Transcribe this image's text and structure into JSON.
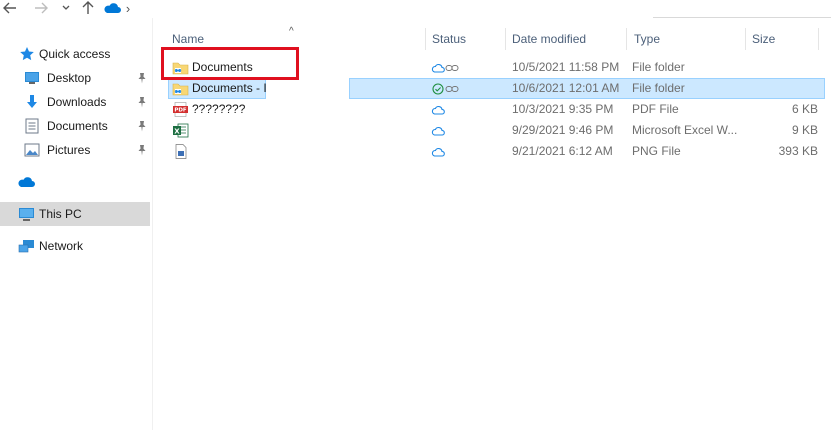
{
  "window": {
    "nav": {
      "back_icon": "back-arrow-icon",
      "forward_icon": "forward-arrow-icon",
      "recent_icon": "chevron-down-icon",
      "up_icon": "up-arrow-icon"
    },
    "address": {
      "location_icon": "onedrive-cloud-icon",
      "separator": "›"
    }
  },
  "sidebar": {
    "items": [
      {
        "label": "Quick access",
        "icon": "star-icon"
      },
      {
        "label": "Desktop",
        "icon": "desktop-icon",
        "pinned": true
      },
      {
        "label": "Downloads",
        "icon": "download-icon",
        "pinned": true
      },
      {
        "label": "Documents",
        "icon": "documents-icon",
        "pinned": true
      },
      {
        "label": "Pictures",
        "icon": "pictures-icon",
        "pinned": true
      },
      {
        "label": "",
        "icon": "onedrive-cloud-icon"
      },
      {
        "label": "This PC",
        "icon": "pc-icon",
        "selected": true
      },
      {
        "label": "Network",
        "icon": "network-icon"
      }
    ]
  },
  "columns": {
    "sort_indicator": "^",
    "name": "Name",
    "status": "Status",
    "date_modified": "Date modified",
    "type": "Type",
    "size": "Size"
  },
  "files": [
    {
      "name": "Documents",
      "icon": "shared-folder-icon",
      "status": "cloud-link",
      "date": "10/5/2021 11:58 PM",
      "type": "File folder",
      "size": ""
    },
    {
      "name": "Documents - I",
      "icon": "shared-folder-icon",
      "status": "synced-link",
      "date": "10/6/2021 12:01 AM",
      "type": "File folder",
      "size": "",
      "selected": true
    },
    {
      "name": "????????",
      "icon": "pdf-file-icon",
      "status": "cloud",
      "date": "10/3/2021 9:35 PM",
      "type": "PDF File",
      "size": "6 KB"
    },
    {
      "name": "",
      "icon": "excel-file-icon",
      "status": "cloud",
      "date": "9/29/2021 9:46 PM",
      "type": "Microsoft Excel W...",
      "size": "9 KB"
    },
    {
      "name": "",
      "icon": "png-file-icon",
      "status": "cloud",
      "date": "9/21/2021 6:12 AM",
      "type": "PNG File",
      "size": "393 KB"
    }
  ],
  "colors": {
    "accent": "#0078d7",
    "selection": "#cce8ff",
    "highlight": "#e0101f",
    "synced": "#1e8e3e"
  }
}
